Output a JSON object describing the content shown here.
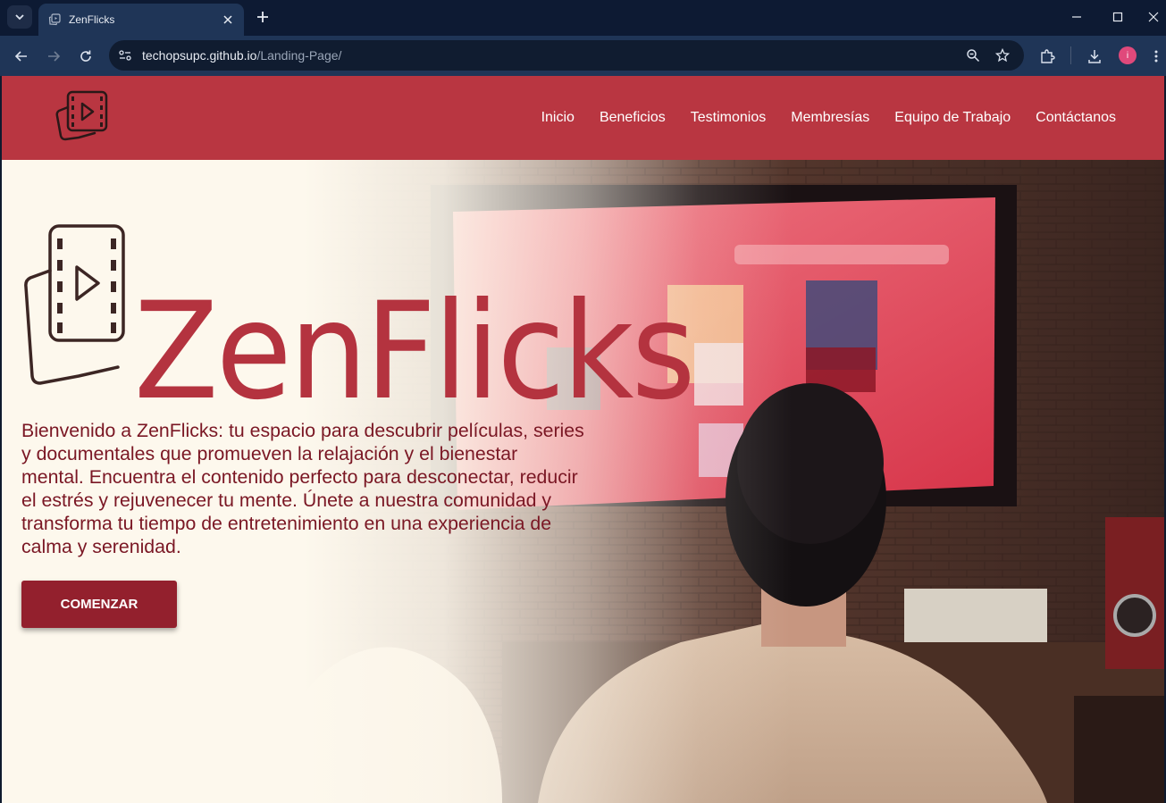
{
  "browser": {
    "tab_title": "ZenFlicks",
    "url_host": "techopsupc.github.io",
    "url_path": "/Landing-Page/",
    "profile_initial": "i"
  },
  "nav": {
    "links": [
      "Inicio",
      "Beneficios",
      "Testimonios",
      "Membresías",
      "Equipo de Trabajo",
      "Contáctanos"
    ]
  },
  "hero": {
    "brand_name": "ZenFlicks",
    "description": "Bienvenido a ZenFlicks: tu espacio para descubrir películas, series y documentales que promueven la relajación y el bienestar mental. Encuentra el contenido perfecto para desconectar, reducir el estrés y rejuvenecer tu mente. Únete a nuestra comunidad y transforma tu tiempo de entretenimiento en una experiencia de calma y serenidad.",
    "cta_label": "COMENZAR"
  },
  "colors": {
    "nav_bg": "#b93641",
    "brand": "#b4333f",
    "text": "#7a1724",
    "cta_bg": "#93202d",
    "hero_bg": "#fdf8ed"
  },
  "icons": [
    "tab-list-icon",
    "zenflicks-favicon",
    "close-icon",
    "plus-icon",
    "minimize-icon",
    "maximize-icon",
    "back-icon",
    "forward-icon",
    "reload-icon",
    "site-info-icon",
    "zoom-icon",
    "star-icon",
    "extensions-icon",
    "download-icon",
    "film-logo-icon"
  ]
}
